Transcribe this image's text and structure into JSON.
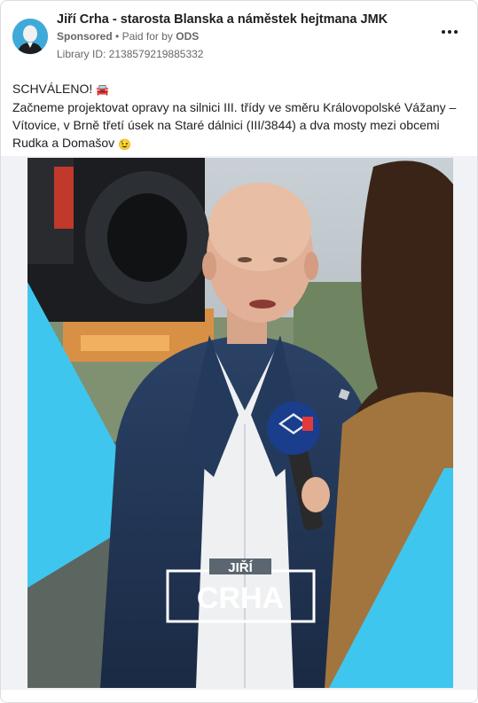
{
  "header": {
    "page_name": "Jiří Crha - starosta Blanska a náměstek hejtmana JMK",
    "sponsored": "Sponsored",
    "separator": "•",
    "paid_for_prefix": "Paid for by",
    "paid_for_by": "ODS",
    "library_id": "Library ID: 2138579219885332"
  },
  "post": {
    "line1": "SCHVÁLENO!",
    "line1_emoji": "🚘",
    "body": "Začneme projektovat opravy na silnici III. třídy ve směru Královopolské Vážany – Vítovice, v Brně třetí úsek na Staré dálnici (III/3844) a dva mosty mezi obcemi Rudka a Domašov",
    "body_emoji": "😉"
  },
  "image": {
    "logo_top": "JIŘÍ",
    "logo_bottom": "CRHA",
    "accent_color": "#3fc6ef"
  }
}
